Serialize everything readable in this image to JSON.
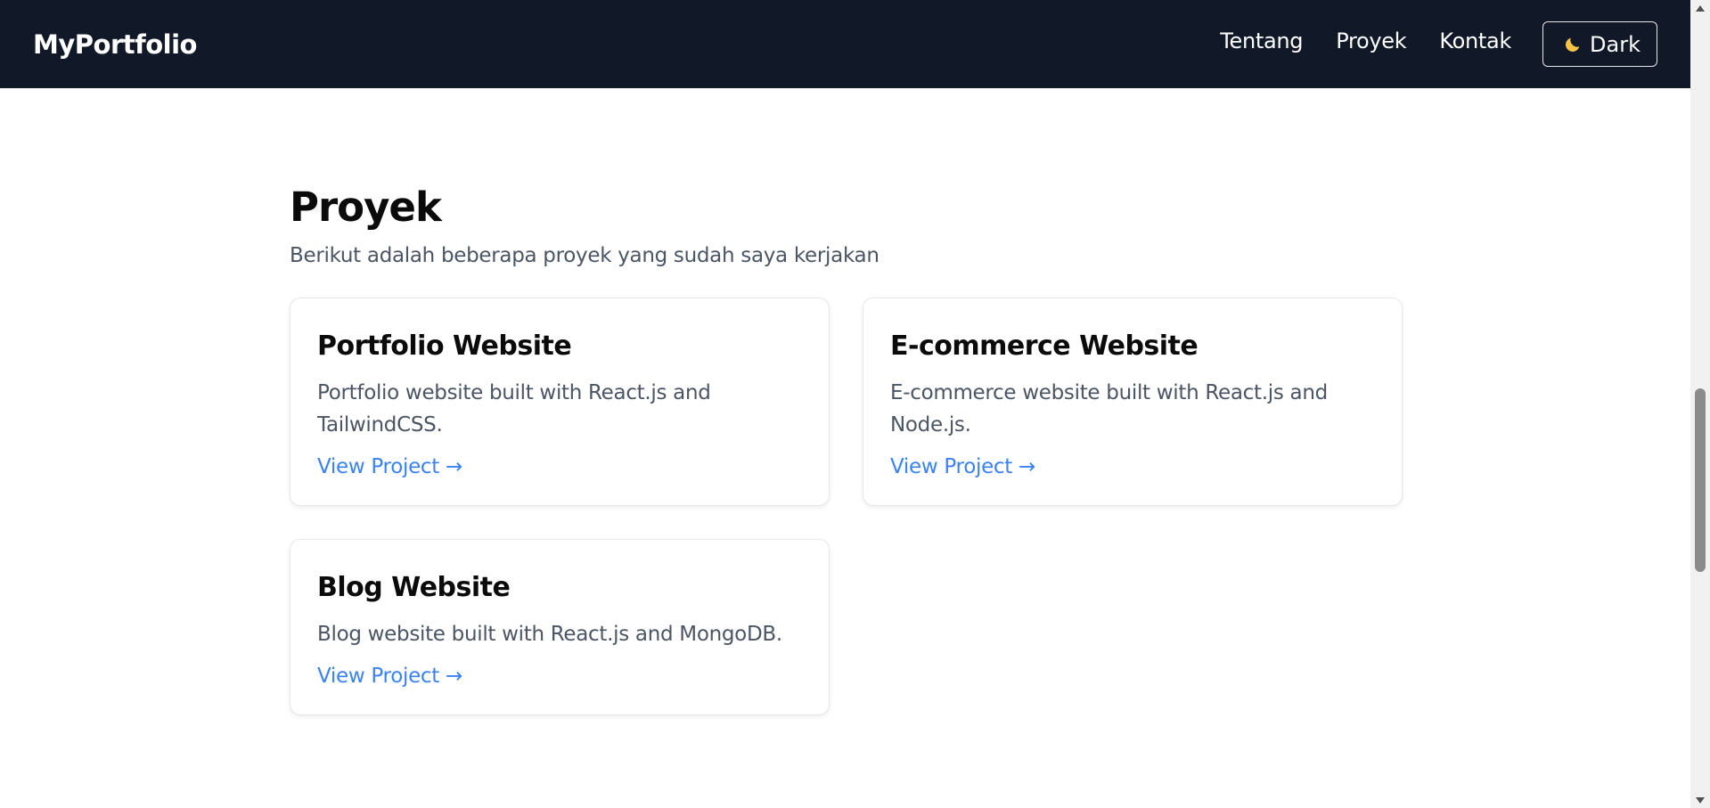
{
  "navbar": {
    "brand": "MyPortfolio",
    "links": [
      "Tentang",
      "Proyek",
      "Kontak"
    ],
    "theme_toggle": {
      "icon": "moon-icon",
      "label": "Dark"
    },
    "bg_color": "#111827"
  },
  "section": {
    "title": "Proyek",
    "subtitle": "Berikut adalah beberapa proyek yang sudah saya kerjakan"
  },
  "projects": [
    {
      "title": "Portfolio Website",
      "description": "Portfolio website built with React.js and TailwindCSS.",
      "link": "View Project →"
    },
    {
      "title": "E-commerce Website",
      "description": "E-commerce website built with React.js and Node.js.",
      "link": "View Project →"
    },
    {
      "title": "Blog Website",
      "description": "Blog website built with React.js and MongoDB.",
      "link": "View Project →"
    }
  ],
  "colors": {
    "link": "#3b82f6",
    "muted_text": "#4b5563",
    "moon": "#f6c445"
  }
}
